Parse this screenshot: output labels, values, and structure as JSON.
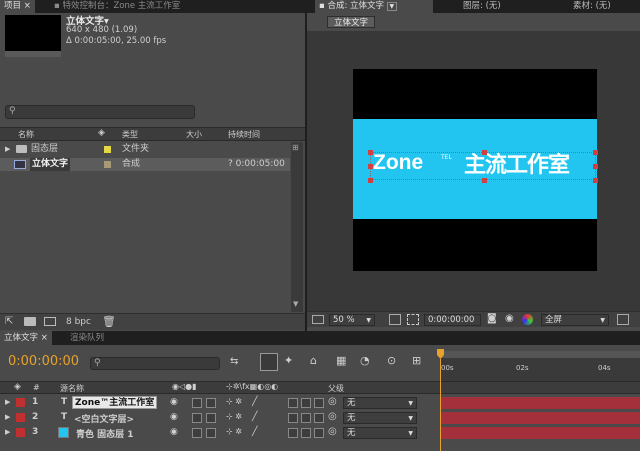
{
  "project_panel": {
    "tab_label": "项目",
    "tab2_label": "特效控制台：Zone    主流工作室",
    "comp_name": "立体文字▾",
    "comp_size": "640 x 480 (1.09)",
    "comp_duration": "Δ 0:00:05:00, 25.00 fps",
    "search_placeholder": "",
    "columns": {
      "name": "名称",
      "type": "类型",
      "size": "大小",
      "duration": "持续时间"
    },
    "items": [
      {
        "name": "固态层",
        "type": "文件夹",
        "duration": "",
        "label_color": "#e4d844"
      },
      {
        "name": "立体文字",
        "type": "合成",
        "duration": "? 0:00:05:00",
        "label_color": "#a89a74"
      }
    ],
    "bpc": "8 bpc"
  },
  "comp_panel": {
    "tab_label": "合成: 立体文字",
    "layer_tab": "图层: (无)",
    "footage_tab": "素材: (无)",
    "subtab": "立体文字",
    "canvas_text_main": "Zone",
    "canvas_text_tel": "TEL",
    "canvas_text_cn": "主流工作室",
    "zoom": "50 %",
    "timecode": "0:00:00:00",
    "resolution": "全屏",
    "canvas_band_color": "#22c5f0"
  },
  "timeline": {
    "tab_label": "立体文字",
    "tab2_label": "渲染队列",
    "current_time": "0:00:00:00",
    "search_placeholder": "",
    "col_hash": "#",
    "col_source": "源名称",
    "col_parent": "父级",
    "ruler_labels": [
      "00s",
      "02s",
      "04s"
    ],
    "layers": [
      {
        "num": "1",
        "type_icon": "T",
        "name": "Zone™主流工作室",
        "parent": "无",
        "label_color": "#c03030"
      },
      {
        "num": "2",
        "type_icon": "T",
        "name": "<空白文字层>",
        "parent": "无",
        "label_color": "#c03030"
      },
      {
        "num": "3",
        "type_icon": "",
        "name": "青色 固态层 1",
        "parent": "无",
        "label_color": "#c03030",
        "swatch": "#22c5f0"
      }
    ]
  }
}
